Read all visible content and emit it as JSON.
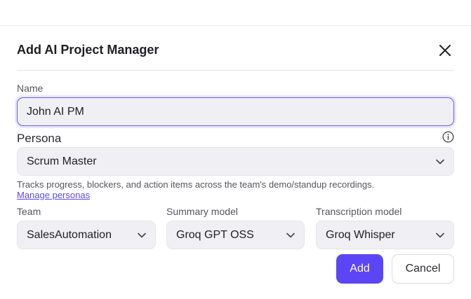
{
  "dialog": {
    "title": "Add AI Project Manager"
  },
  "name": {
    "label": "Name",
    "value": "John AI PM"
  },
  "persona": {
    "label": "Persona",
    "selected": "Scrum Master",
    "hint": "Tracks progress, blockers, and action items across the team's demo/standup recordings.",
    "manage_link": "Manage personas"
  },
  "team": {
    "label": "Team",
    "selected": "SalesAutomation"
  },
  "summary_model": {
    "label": "Summary model",
    "selected": "Groq GPT OSS"
  },
  "transcription_model": {
    "label": "Transcription model",
    "selected": "Groq Whisper"
  },
  "actions": {
    "add_label": "Add",
    "cancel_label": "Cancel"
  },
  "colors": {
    "primary": "#5b45f5",
    "focus_border": "#6a5ce8",
    "link": "#5b49e6",
    "field_bg": "#f0f0f4"
  },
  "icons": {
    "close": "close-icon",
    "info": "info-icon",
    "dropdown": "chevron-down-icon"
  }
}
